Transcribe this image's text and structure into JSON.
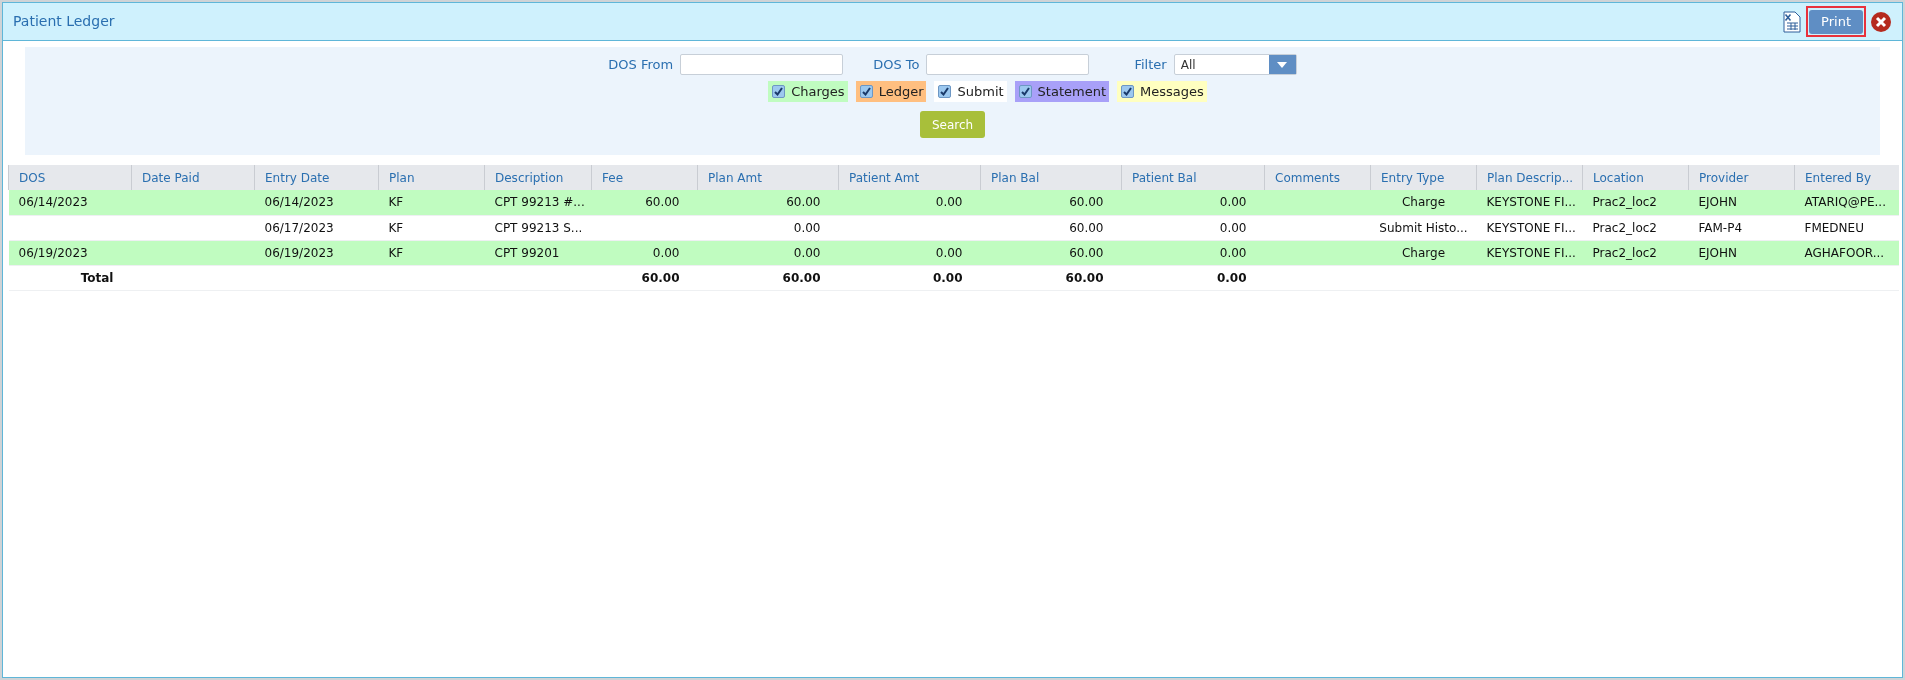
{
  "window": {
    "title": "Patient Ledger"
  },
  "toolbar": {
    "print_label": "Print"
  },
  "filters": {
    "dos_from_label": "DOS From",
    "dos_to_label": "DOS To",
    "filter_label": "Filter",
    "filter_value": "All",
    "types": [
      {
        "label": "Charges",
        "checked": true,
        "color": "#c0fcc0"
      },
      {
        "label": "Ledger",
        "checked": true,
        "color": "#ffbf80"
      },
      {
        "label": "Submit",
        "checked": true,
        "color": "#ffffff"
      },
      {
        "label": "Statement",
        "checked": true,
        "color": "#a8a0f8"
      },
      {
        "label": "Messages",
        "checked": true,
        "color": "#ffffc0"
      }
    ],
    "search_label": "Search"
  },
  "table": {
    "columns": [
      "DOS",
      "Date Paid",
      "Entry Date",
      "Plan",
      "Description",
      "Fee",
      "Plan Amt",
      "Patient Amt",
      "Plan Bal",
      "Patient Bal",
      "Comments",
      "Entry Type",
      "Plan Descrip...",
      "Location",
      "Provider",
      "Entered By"
    ],
    "rows": [
      {
        "kind": "charge",
        "cells": [
          "06/14/2023",
          null,
          "06/14/2023",
          "KF",
          "CPT 99213 #...",
          "60.00",
          "60.00",
          "0.00",
          "60.00",
          "0.00",
          null,
          "Charge",
          "KEYSTONE FI...",
          "Prac2_loc2",
          "EJOHN",
          "ATARIQ@PE..."
        ]
      },
      {
        "kind": "submit",
        "cells": [
          null,
          null,
          "06/17/2023",
          "KF",
          "CPT 99213 S...",
          null,
          "0.00",
          null,
          "60.00",
          "0.00",
          null,
          "Submit Histo...",
          "KEYSTONE FI...",
          "Prac2_loc2",
          "FAM-P4",
          "FMEDNEU"
        ]
      },
      {
        "kind": "charge",
        "cells": [
          "06/19/2023",
          null,
          "06/19/2023",
          "KF",
          "CPT 99201",
          "0.00",
          "0.00",
          "0.00",
          "60.00",
          "0.00",
          null,
          "Charge",
          "KEYSTONE FI...",
          "Prac2_loc2",
          "EJOHN",
          "AGHAFOOR..."
        ]
      },
      {
        "kind": "total",
        "cells": [
          "Total",
          null,
          null,
          null,
          null,
          "60.00",
          "60.00",
          "0.00",
          "60.00",
          "0.00",
          null,
          null,
          null,
          null,
          null,
          null
        ]
      }
    ]
  }
}
